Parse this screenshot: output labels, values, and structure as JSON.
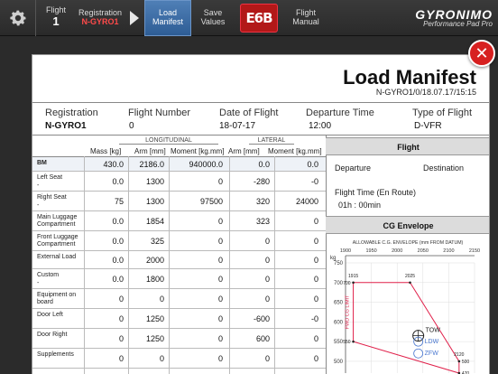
{
  "topbar": {
    "flight_label": "Flight",
    "flight_value": "1",
    "registration_label": "Registration",
    "registration_value": "N-GYRO1",
    "load_manifest": [
      "Load",
      "Manifest"
    ],
    "save_values": [
      "Save",
      "Values"
    ],
    "flight_manual": [
      "Flight",
      "Manual"
    ],
    "logo_badge": "E6B",
    "brand_name": "GYRONIMO",
    "brand_sub": "Performance Pad Pro"
  },
  "manifest": {
    "title": "Load Manifest",
    "id": "N-GYRO1/0/18.07.17/15:15",
    "info": {
      "headers": [
        "Registration",
        "Flight Number",
        "Date of Flight",
        "Departure Time",
        "Type of Flight"
      ],
      "values": [
        "N-GYRO1",
        "0",
        "18-07-17",
        "12:00",
        "D-VFR"
      ]
    },
    "groups": {
      "longitudinal": "LONGITUDINAL",
      "lateral": "LATERAL"
    },
    "columns": [
      "Mass [kg]",
      "Arm [mm]",
      "Moment [kg.mm]",
      "Arm [mm]",
      "Moment [kg.mm]"
    ],
    "rows": [
      {
        "label": "BM",
        "sub": "",
        "values": [
          "430.0",
          "2186.0",
          "940000.0",
          "0.0",
          "0.0"
        ]
      },
      {
        "label": "Left Seat",
        "sub": "-",
        "values": [
          "0.0",
          "1300",
          "0",
          "-280",
          "-0"
        ]
      },
      {
        "label": "Right Seat",
        "sub": "-",
        "values": [
          "75",
          "1300",
          "97500",
          "320",
          "24000"
        ]
      },
      {
        "label": "Main Luggage Compartment",
        "sub": "",
        "values": [
          "0.0",
          "1854",
          "0",
          "323",
          "0"
        ]
      },
      {
        "label": "Front Luggage Compartment",
        "sub": "",
        "values": [
          "0.0",
          "325",
          "0",
          "0",
          "0"
        ]
      },
      {
        "label": "External Load",
        "sub": "",
        "values": [
          "0.0",
          "2000",
          "0",
          "0",
          "0"
        ]
      },
      {
        "label": "Custom",
        "sub": "-",
        "values": [
          "0.0",
          "1800",
          "0",
          "0",
          "0"
        ]
      },
      {
        "label": "Equipment on board",
        "sub": "",
        "values": [
          "0",
          "0",
          "0",
          "0",
          "0"
        ]
      },
      {
        "label": "Door Left",
        "sub": "",
        "values": [
          "0",
          "1250",
          "0",
          "-600",
          "-0"
        ]
      },
      {
        "label": "Door Right",
        "sub": "",
        "values": [
          "0",
          "1250",
          "0",
          "600",
          "0"
        ]
      },
      {
        "label": "Supplements",
        "sub": "",
        "values": [
          "0",
          "0",
          "0",
          "0",
          "0"
        ]
      }
    ],
    "flight_panel": {
      "header": "Flight",
      "departure": "Departure",
      "destination": "Destination",
      "flight_time_label": "Flight Time (En Route)",
      "flight_time_value": "01h : 00min"
    },
    "cg_panel": {
      "header": "CG Envelope"
    }
  },
  "chart_data": {
    "type": "line",
    "title": "ALLOWABLE C.G. ENVELOPE (mm FROM DATUM)",
    "ylabel": "kg",
    "xlim": [
      1900,
      2150
    ],
    "ylim": [
      470,
      750
    ],
    "x_ticks": [
      1900,
      1950,
      2000,
      2050,
      2100,
      2150
    ],
    "y_ticks": [
      500,
      550,
      600,
      650,
      700,
      750
    ],
    "envelope": [
      {
        "x": 1915,
        "y": 700
      },
      {
        "x": 2025,
        "y": 700
      },
      {
        "x": 2120,
        "y": 500
      },
      {
        "x": 2120,
        "y": 470
      },
      {
        "x": 1915,
        "y": 550
      }
    ],
    "point_labels": [
      "1915",
      "2025",
      "700",
      "550",
      "2120",
      "500",
      "470"
    ],
    "annotations": [
      "FWD CG LIMIT",
      "TOW",
      "LDW",
      "ZFW"
    ],
    "markers": [
      {
        "name": "TOW",
        "x": 2041,
        "y": 565
      },
      {
        "name": "LDW",
        "x": 2041,
        "y": 550
      },
      {
        "name": "ZFW",
        "x": 2041,
        "y": 520
      }
    ],
    "colors": {
      "envelope": "#e0204a",
      "markers": "#4a78d0"
    }
  }
}
